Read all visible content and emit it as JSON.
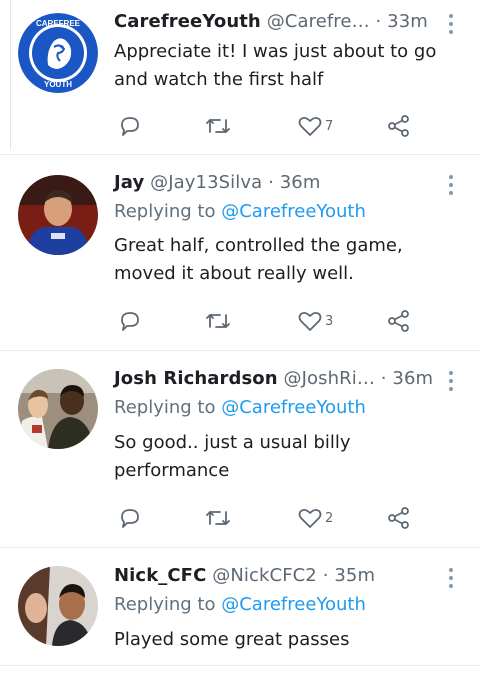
{
  "tweets": [
    {
      "name": "CarefreeYouth",
      "handle": "@Carefre…",
      "time": "33m",
      "replying_prefix": "",
      "replying_to": "",
      "text": "Appreciate it! I was just about to go and watch the first half",
      "likes": "7",
      "avatar": {
        "kind": "logo",
        "ring_text_top": "CAREFREE",
        "ring_text_bottom": "YOUTH",
        "color": "#1a56c4"
      }
    },
    {
      "name": "Jay",
      "handle": "@Jay13Silva",
      "time": "36m",
      "replying_prefix": "Replying to",
      "replying_to": "@CarefreeYouth",
      "text": "Great half, controlled the game, moved it about really well.",
      "likes": "3",
      "avatar": {
        "kind": "photo"
      }
    },
    {
      "name": "Josh Richardson",
      "handle": "@JoshRi…",
      "time": "36m",
      "replying_prefix": "Replying to",
      "replying_to": "@CarefreeYouth",
      "text": "So good.. just a usual billy performance",
      "likes": "2",
      "avatar": {
        "kind": "photo"
      }
    },
    {
      "name": "Nick_CFC",
      "handle": "@NickCFC2",
      "time": "35m",
      "replying_prefix": "Replying to",
      "replying_to": "@CarefreeYouth",
      "text": "Played some great passes",
      "likes": "",
      "avatar": {
        "kind": "photo"
      }
    }
  ],
  "separator": "·",
  "icons": {
    "reply": "reply-icon",
    "retweet": "retweet-icon",
    "like": "heart-icon",
    "share": "share-icon",
    "more": "more-vertical-icon"
  },
  "colors": {
    "link": "#1d9bf0",
    "icon": "#5c6873",
    "divider": "#e6ecf0"
  }
}
